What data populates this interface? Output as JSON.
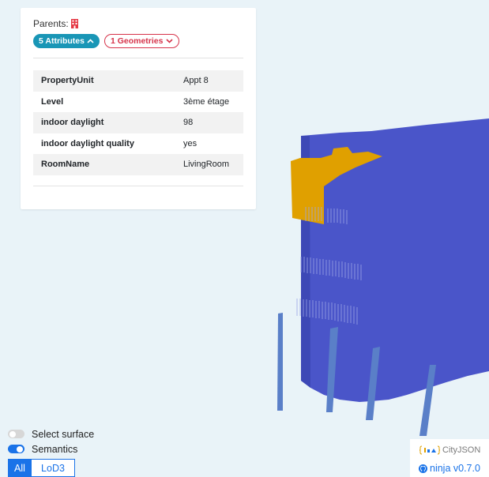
{
  "parents": {
    "label": "Parents:",
    "icon": "building-icon"
  },
  "badges": {
    "attributes": "5 Attributes",
    "geometries": "1 Geometries"
  },
  "attributes": [
    {
      "key": "PropertyUnit",
      "value": "Appt 8"
    },
    {
      "key": "Level",
      "value": "3ème étage"
    },
    {
      "key": "indoor daylight",
      "value": "98"
    },
    {
      "key": "indoor daylight quality",
      "value": "yes"
    },
    {
      "key": "RoomName",
      "value": "LivingRoom"
    }
  ],
  "controls": {
    "select_surface": {
      "label": "Select surface",
      "enabled": false
    },
    "semantics": {
      "label": "Semantics",
      "enabled": true
    }
  },
  "lod": {
    "all_label": "All",
    "lod3_label": "LoD3",
    "active": "All"
  },
  "branding": {
    "cityjson": "CityJSON",
    "ninja": "ninja v0.7.0"
  },
  "colors": {
    "accent": "#1a73e8",
    "attributes_badge": "#1996b6",
    "geometries_badge": "#d6334a",
    "wall": "#4a55c9",
    "selected_surface": "#e0a000",
    "background": "#e9f3f8"
  }
}
